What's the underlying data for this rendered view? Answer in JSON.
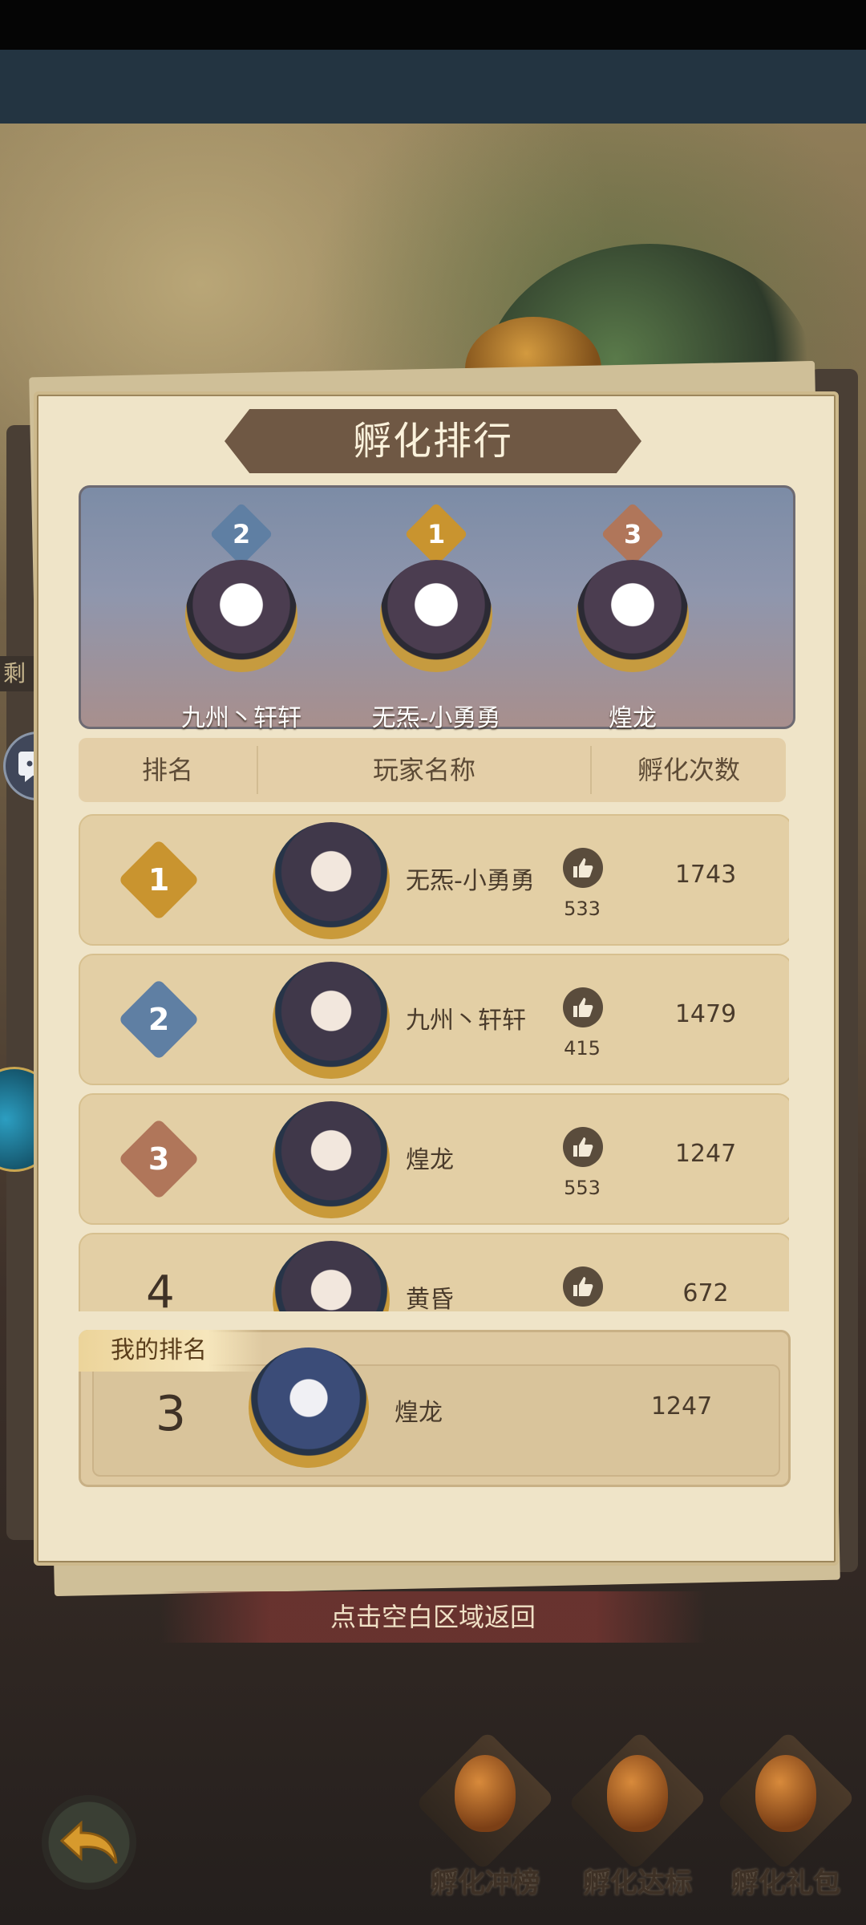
{
  "title": "孵化排行",
  "left_tab_text": "剩",
  "podium": [
    {
      "rank": "2",
      "name": "九州丶轩轩"
    },
    {
      "rank": "1",
      "name": "无炁-小勇勇"
    },
    {
      "rank": "3",
      "name": "煌龙"
    }
  ],
  "table_headers": {
    "rank": "排名",
    "player": "玩家名称",
    "count": "孵化次数"
  },
  "rows": [
    {
      "rank": "1",
      "name": "无炁-小勇勇",
      "likes": "533",
      "count": "1743"
    },
    {
      "rank": "2",
      "name": "九州丶轩轩",
      "likes": "415",
      "count": "1479"
    },
    {
      "rank": "3",
      "name": "煌龙",
      "likes": "553",
      "count": "1247"
    },
    {
      "rank": "4",
      "name": "黄昏",
      "likes": "",
      "count": "672"
    }
  ],
  "my_rank": {
    "label": "我的排名",
    "rank": "3",
    "name": "煌龙",
    "count": "1247"
  },
  "return_hint": "点击空白区域返回",
  "bottom_buttons": [
    {
      "label": "孵化冲榜"
    },
    {
      "label": "孵化达标"
    },
    {
      "label": "孵化礼包"
    }
  ],
  "colors": {
    "gold_badge": "#c9942f",
    "silver_badge": "#5f7fa3",
    "bronze_badge": "#b0765a",
    "card_bg": "#efe4c8"
  },
  "icons": [
    "chat-icon",
    "thumb-up-icon",
    "back-arrow-icon",
    "rank-badge-icon",
    "egg-icon"
  ]
}
